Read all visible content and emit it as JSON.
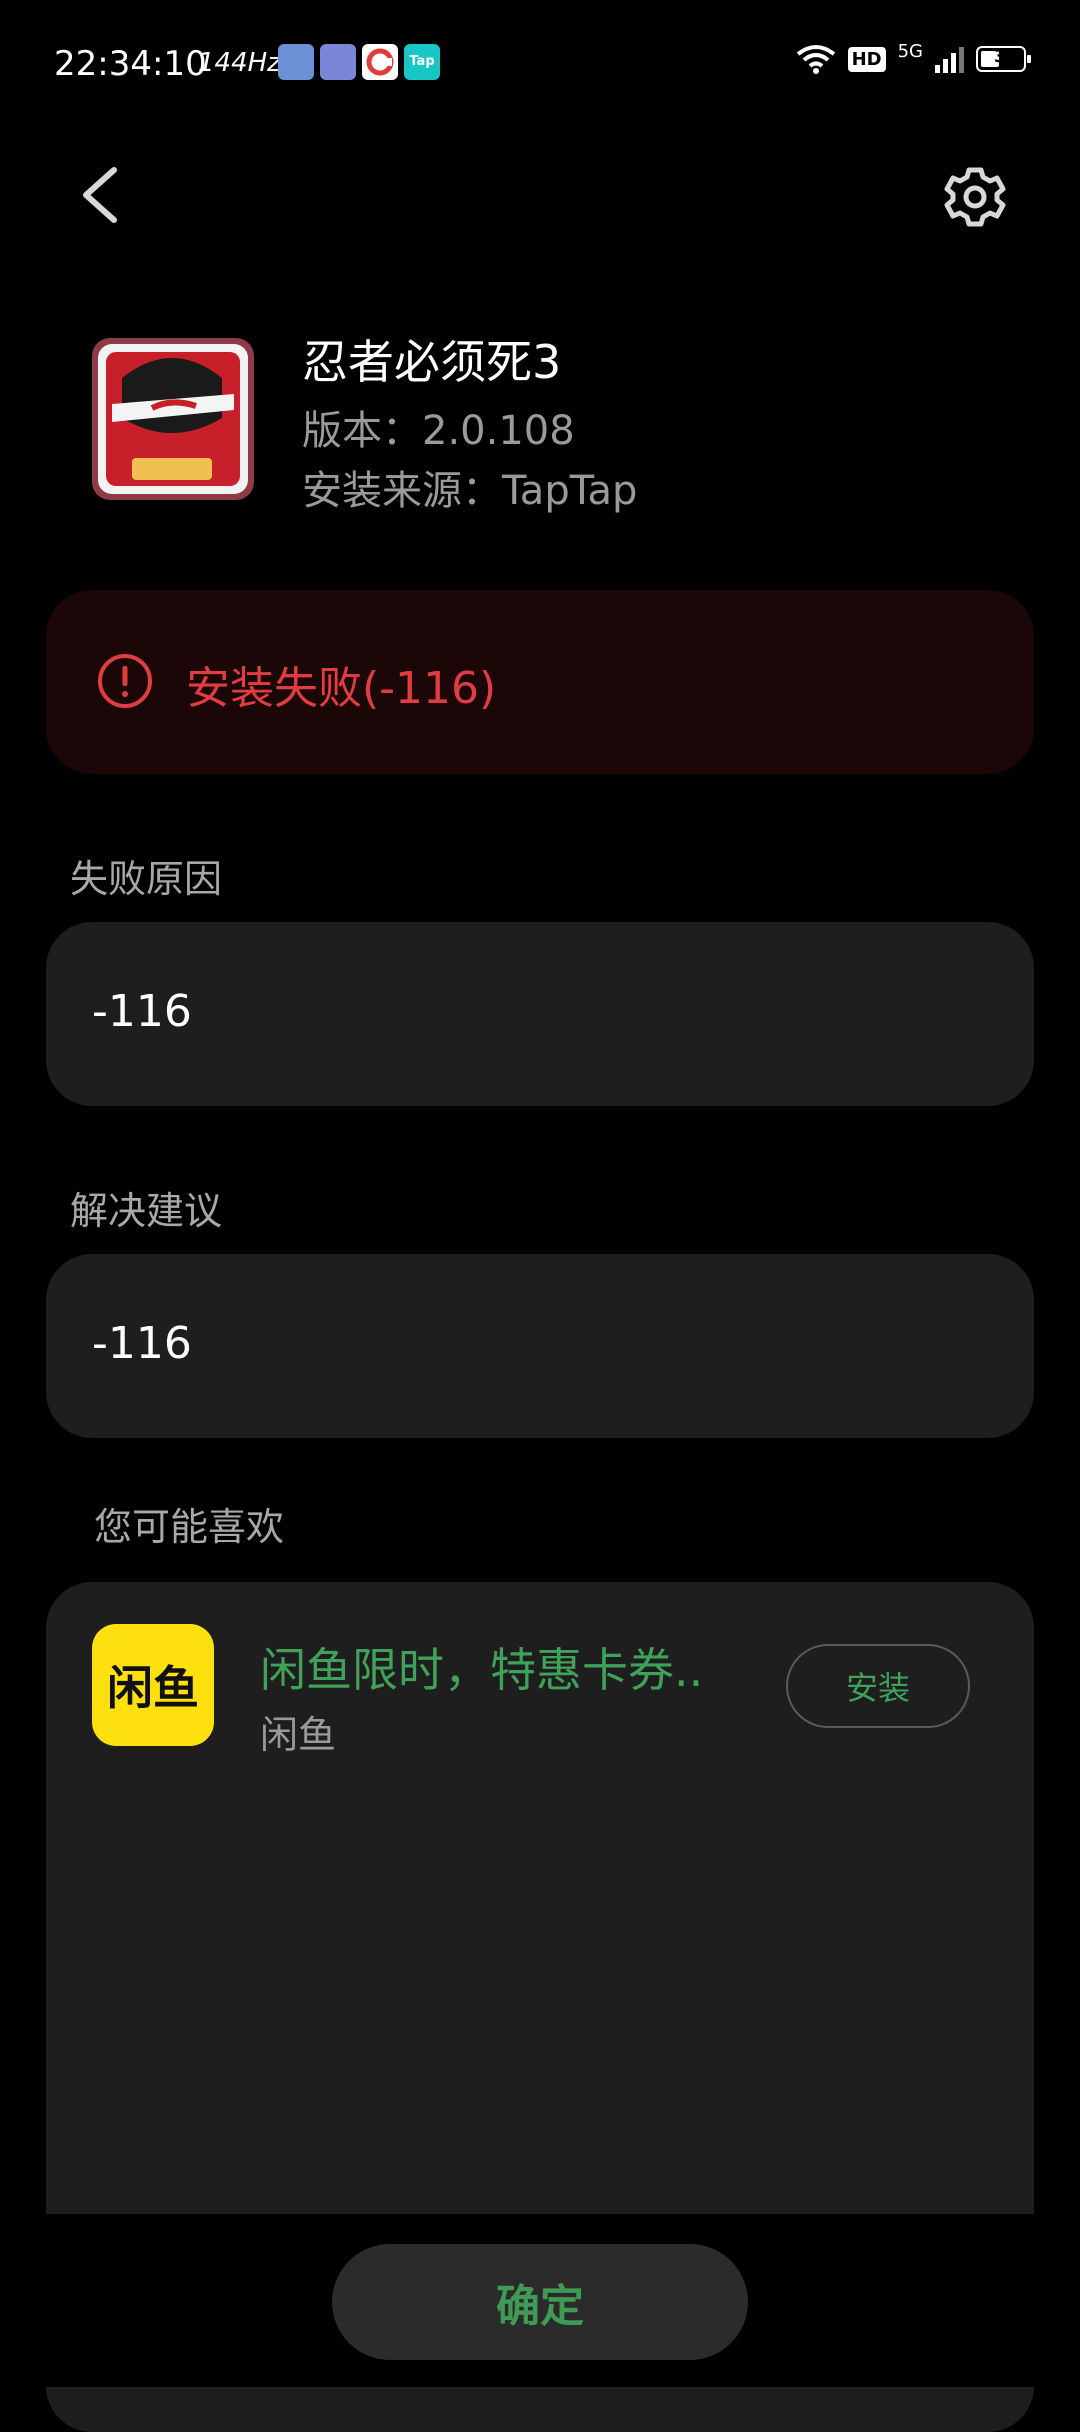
{
  "status_bar": {
    "time": "22:34:10",
    "refresh_rate": "144Hz",
    "notification_icons": [
      "gallery-app-icon",
      "cloud-app-icon",
      "c-app-icon",
      "taptap-app-icon"
    ],
    "tap_label": "Tap",
    "hd_label": "HD",
    "network": "5G",
    "battery": "31"
  },
  "header": {
    "back_icon": "chevron-left-icon",
    "settings_icon": "gear-icon"
  },
  "app": {
    "name": "忍者必须死3",
    "version": "版本：2.0.108",
    "source": "安装来源：TapTap"
  },
  "error": {
    "icon": "alert-circle-icon",
    "message": "安装失败(-116)",
    "color": "#e13c42"
  },
  "failure_reason": {
    "label": "失败原因",
    "value": "-116"
  },
  "suggestion": {
    "label": "解决建议",
    "value": "-116"
  },
  "recommendation": {
    "section_label": "您可能喜欢",
    "items": [
      {
        "title": "闲鱼限时，特惠卡券..",
        "app_name": "闲鱼",
        "icon_text": "闲鱼",
        "install_label": "安装"
      }
    ]
  },
  "footer": {
    "confirm_label": "确定",
    "accent_color": "#3fa15a"
  }
}
